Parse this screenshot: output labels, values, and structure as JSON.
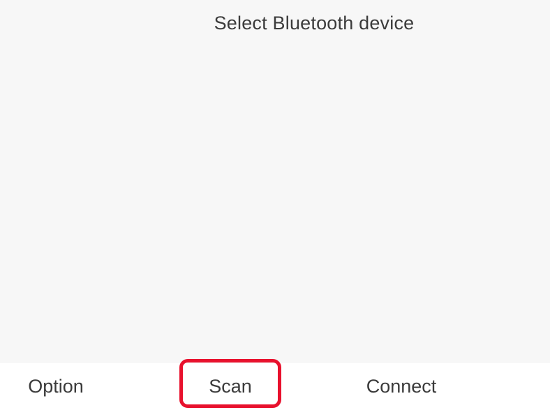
{
  "screen": {
    "title": "Select Bluetooth device"
  },
  "softkeys": {
    "option": "Option",
    "scan": "Scan",
    "connect": "Connect"
  },
  "colors": {
    "highlight": "#e8112d",
    "screen_background": "#f7f7f7",
    "text": "#3b3b3b"
  }
}
